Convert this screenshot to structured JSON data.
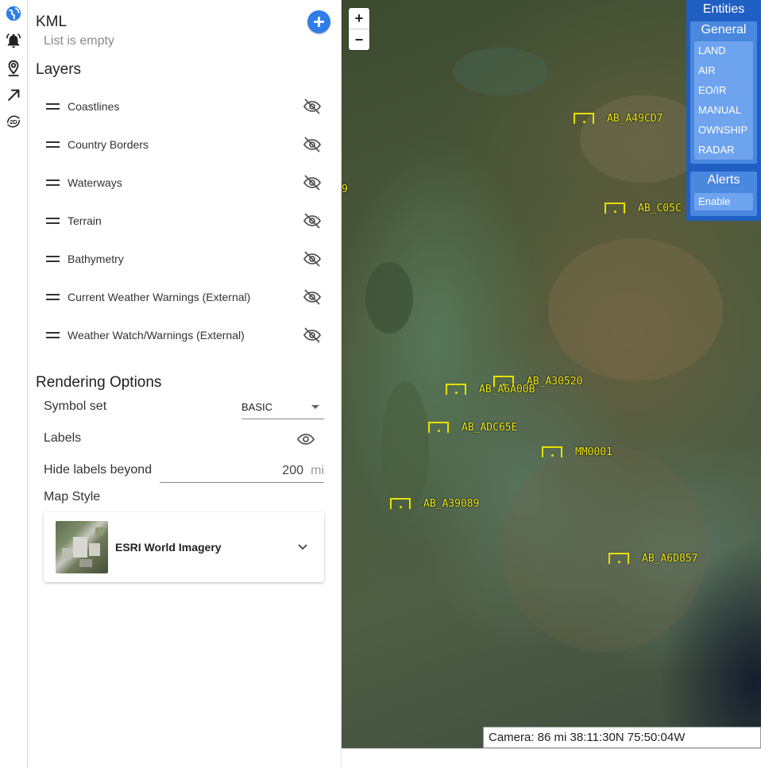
{
  "rail": {
    "icons": [
      "globe-icon",
      "alarm-bell-icon",
      "map-pin-icon",
      "arrow-up-right-icon",
      "view-2d-icon"
    ],
    "view_mode": "2D"
  },
  "kml": {
    "title": "KML",
    "empty_text": "List is empty"
  },
  "layers": {
    "title": "Layers",
    "items": [
      {
        "label": "Coastlines",
        "visible": false
      },
      {
        "label": "Country Borders",
        "visible": false
      },
      {
        "label": "Waterways",
        "visible": false
      },
      {
        "label": "Terrain",
        "visible": false
      },
      {
        "label": "Bathymetry",
        "visible": false
      },
      {
        "label": "Current Weather Warnings (External)",
        "visible": false
      },
      {
        "label": "Weather Watch/Warnings (External)",
        "visible": false
      }
    ]
  },
  "rendering": {
    "title": "Rendering Options",
    "symbol_set_label": "Symbol set",
    "symbol_set_value": "BASIC",
    "labels_label": "Labels",
    "labels_visible": true,
    "hide_labels_label": "Hide labels beyond",
    "hide_labels_value": "200",
    "hide_labels_unit": "mi",
    "map_style_label": "Map Style",
    "map_style_value": "ESRI World Imagery"
  },
  "map": {
    "zoom_in": "+",
    "zoom_out": "−",
    "tracks": [
      {
        "label": "AB_A49CD7"
      },
      {
        "label": "AB_C05C"
      },
      {
        "label": "AB_A30520"
      },
      {
        "label": "AB_A6A00B"
      },
      {
        "label": "AB_ADC65E"
      },
      {
        "label": "MM0001"
      },
      {
        "label": "AB_A39089"
      },
      {
        "label": "AB_A6D857"
      }
    ],
    "edge_label": "9",
    "camera": "Camera: 86 mi 38:11:30N 75:50:04W"
  },
  "entities": {
    "title": "Entities",
    "general_title": "General",
    "general_items": [
      "LAND",
      "AIR",
      "EO/IR",
      "MANUAL",
      "OWNSHIP",
      "RADAR"
    ],
    "alerts_title": "Alerts",
    "alerts_button": "Enable"
  },
  "colors": {
    "accent": "#2f7ee8",
    "entities_panel": "#1f5fc4",
    "track_symbol": "#e8e000"
  }
}
